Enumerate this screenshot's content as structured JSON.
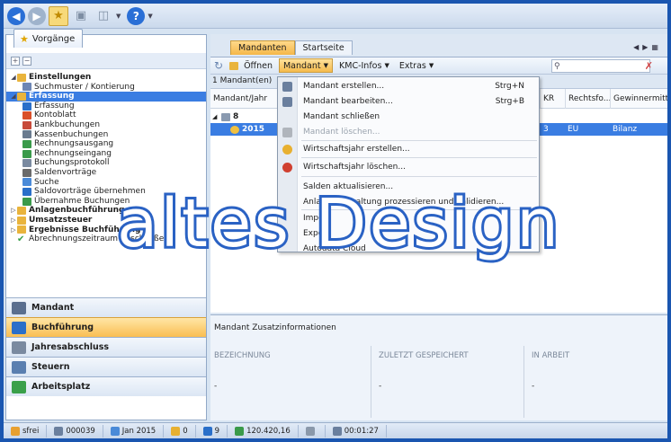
{
  "quick_access": {
    "icons": [
      "back-icon",
      "forward-icon",
      "favorite-star-icon",
      "save-icon",
      "print-icon",
      "help-icon"
    ]
  },
  "left_panel": {
    "tab_label": "Vorgänge",
    "tree": [
      {
        "label": "Einstellungen",
        "bold": true,
        "level": 0,
        "arrow": "◢",
        "color": "#e9b43c"
      },
      {
        "label": "Suchmuster / Kontierung",
        "bold": false,
        "level": 1,
        "arrow": "",
        "color": "#6d86b4"
      },
      {
        "label": "Erfassung",
        "bold": true,
        "level": 0,
        "arrow": "◢",
        "color": "#e9b43c",
        "selected": true
      },
      {
        "label": "Erfassung",
        "bold": false,
        "level": 1,
        "arrow": "",
        "color": "#2a6fc9"
      },
      {
        "label": "Kontoblatt",
        "bold": false,
        "level": 1,
        "arrow": "",
        "color": "#d9502a"
      },
      {
        "label": "Bankbuchungen",
        "bold": false,
        "level": 1,
        "arrow": "",
        "color": "#c84a3a"
      },
      {
        "label": "Kassenbuchungen",
        "bold": false,
        "level": 1,
        "arrow": "",
        "color": "#6a7b8f"
      },
      {
        "label": "Rechnungsausgang",
        "bold": false,
        "level": 1,
        "arrow": "",
        "color": "#3a9a4a"
      },
      {
        "label": "Rechnungseingang",
        "bold": false,
        "level": 1,
        "arrow": "",
        "color": "#3a9a4a"
      },
      {
        "label": "Buchungsprotokoll",
        "bold": false,
        "level": 1,
        "arrow": "",
        "color": "#7a8aa0"
      },
      {
        "label": "Saldenvorträge",
        "bold": false,
        "level": 1,
        "arrow": "",
        "color": "#6a6a6a"
      },
      {
        "label": "Suche",
        "bold": false,
        "level": 1,
        "arrow": "",
        "color": "#4a8ad8"
      },
      {
        "label": "Saldovorträge übernehmen",
        "bold": false,
        "level": 1,
        "arrow": "",
        "color": "#2a6fc9"
      },
      {
        "label": "Übernahme Buchungen",
        "bold": false,
        "level": 1,
        "arrow": "",
        "color": "#3a9a4a"
      },
      {
        "label": "Anlagenbuchführung",
        "bold": true,
        "level": 0,
        "arrow": "▷",
        "color": "#e9b43c"
      },
      {
        "label": "Umsatzsteuer",
        "bold": true,
        "level": 0,
        "arrow": "▷",
        "color": "#e9b43c"
      },
      {
        "label": "Ergebnisse Buchführung",
        "bold": true,
        "level": 0,
        "arrow": "▷",
        "color": "#e9b43c"
      },
      {
        "label": "Abrechnungszeitraum abschließen",
        "bold": false,
        "level": 0,
        "arrow": "",
        "color": "#3aa04a",
        "check": true
      }
    ],
    "nav": [
      {
        "label": "Mandant",
        "active": false,
        "color": "#5a6f8f"
      },
      {
        "label": "Buchführung",
        "active": true,
        "color": "#2a6fc9"
      },
      {
        "label": "Jahresabschluss",
        "active": false,
        "color": "#7a8aa0"
      },
      {
        "label": "Steuern",
        "active": false,
        "color": "#5a7fb0"
      },
      {
        "label": "Arbeitsplatz",
        "active": false,
        "color": "#3aa04a"
      }
    ]
  },
  "tabs": [
    {
      "label": "Mandanten",
      "active": true
    },
    {
      "label": "Startseite",
      "active": false
    }
  ],
  "toolbar": {
    "open": "Öffnen",
    "mandant": "Mandant",
    "kmc": "KMC-Infos",
    "extras": "Extras"
  },
  "grid": {
    "count": "1 Mandant(en)",
    "columns": [
      "Mandant/Jahr",
      "KR",
      "Rechtsfo...",
      "Gewinnermittl..."
    ],
    "group": "8",
    "row": {
      "year": "2015",
      "kr": "3",
      "rechtsform": "EU",
      "gewinn": "Bilanz"
    }
  },
  "menu": [
    {
      "label": "Mandant erstellen...",
      "shortcut": "Strg+N",
      "icon": "#6a7f9e",
      "disabled": false
    },
    {
      "label": "Mandant bearbeiten...",
      "shortcut": "Strg+B",
      "icon": "#6a7f9e",
      "disabled": false
    },
    {
      "label": "Mandant schließen",
      "shortcut": "",
      "icon": "",
      "disabled": false
    },
    {
      "label": "Mandant löschen...",
      "shortcut": "",
      "icon": "#b0b5bc",
      "disabled": true
    },
    {
      "label": "Wirtschaftsjahr erstellen...",
      "shortcut": "",
      "icon": "#e8b030",
      "disabled": false
    },
    {
      "label": "Wirtschaftsjahr löschen...",
      "shortcut": "",
      "icon": "#d04030",
      "disabled": false
    },
    {
      "label": "Salden aktualisieren...",
      "shortcut": "",
      "icon": "",
      "disabled": false
    },
    {
      "label": "Anlagenverwaltung prozessieren und validieren...",
      "shortcut": "",
      "icon": "",
      "disabled": false
    },
    {
      "label": "Import",
      "shortcut": "",
      "icon": "",
      "disabled": false,
      "submenu": true
    },
    {
      "label": "Export",
      "shortcut": "",
      "icon": "",
      "disabled": false
    },
    {
      "label": "Autodata Cloud",
      "shortcut": "",
      "icon": "",
      "disabled": false
    }
  ],
  "info": {
    "title": "Mandant Zusatzinformationen",
    "cols": [
      {
        "head": "Bezeichnung",
        "value": "-"
      },
      {
        "head": "Zuletzt gespeichert",
        "value": "-"
      },
      {
        "head": "In Arbeit",
        "value": "-"
      }
    ]
  },
  "watermark": "altes Design",
  "status": [
    {
      "text": "sfrei",
      "color": "#e8a030"
    },
    {
      "text": "000039",
      "color": "#6a7f9e"
    },
    {
      "text": "Jan 2015",
      "color": "#4a8ad8"
    },
    {
      "text": "0",
      "color": "#e8b030"
    },
    {
      "text": "9",
      "color": "#2a6fc9"
    },
    {
      "text": "120.420,16",
      "color": "#3a9a4a"
    },
    {
      "text": "",
      "color": "#8a98aa"
    },
    {
      "text": "00:01:27",
      "color": "#6a7f9e"
    }
  ]
}
